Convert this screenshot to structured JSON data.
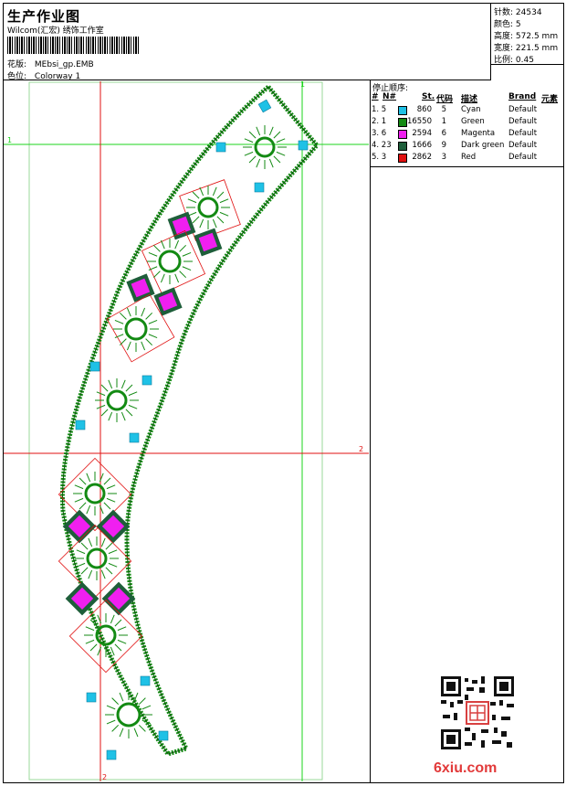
{
  "sheet": {
    "title": "生产作业图",
    "studio": "Wilcom(汇宏) 绣饰工作室",
    "design_label": "花版:",
    "design_value": "MEbsi_gp.EMB",
    "colorway_label": "色位:",
    "colorway_value": "Colorway 1"
  },
  "stats": [
    {
      "label": "针数:",
      "value": "24534"
    },
    {
      "label": "颜色:",
      "value": "5"
    },
    {
      "label": "高度:",
      "value": "572.5 mm"
    },
    {
      "label": "宽度:",
      "value": "221.5 mm"
    },
    {
      "label": "比例:",
      "value": "0.45"
    }
  ],
  "stop_sequence": {
    "title": "停止顺序:",
    "headers": {
      "num": "#",
      "n": "N#",
      "st": "St.",
      "code": "代码",
      "desc": "描述",
      "brand": "Brand",
      "elem": "元素"
    },
    "rows": [
      {
        "num": "1. 5",
        "st": "860",
        "code": "5",
        "desc": "Cyan",
        "brand": "Default",
        "color": "#1fc1e6"
      },
      {
        "num": "2. 1",
        "st": "16550",
        "code": "1",
        "desc": "Green",
        "brand": "Default",
        "color": "#138a13"
      },
      {
        "num": "3. 6",
        "st": "2594",
        "code": "6",
        "desc": "Magenta",
        "brand": "Default",
        "color": "#f01ff0"
      },
      {
        "num": "4. 23",
        "st": "1666",
        "code": "9",
        "desc": "Dark green",
        "brand": "Default",
        "color": "#1e5e3a"
      },
      {
        "num": "5. 3",
        "st": "2862",
        "code": "3",
        "desc": "Red",
        "brand": "Default",
        "color": "#e01010"
      }
    ]
  },
  "guides": {
    "h1": "1",
    "h2": "2",
    "v1": "1",
    "v2": "2"
  },
  "watermark": "6xiu.com"
}
